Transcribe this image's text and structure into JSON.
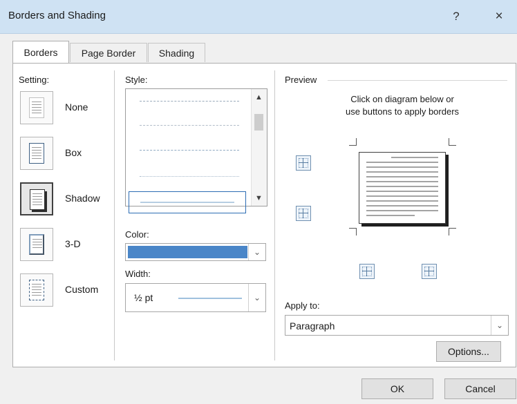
{
  "dialog": {
    "title": "Borders and Shading",
    "help": "?",
    "close": "×"
  },
  "tabs": [
    {
      "label": "Borders",
      "active": true
    },
    {
      "label": "Page Border",
      "active": false
    },
    {
      "label": "Shading",
      "active": false
    }
  ],
  "setting": {
    "heading": "Setting:",
    "options": [
      {
        "label": "None"
      },
      {
        "label": "Box"
      },
      {
        "label": "Shadow",
        "selected": true
      },
      {
        "label": "3-D"
      },
      {
        "label": "Custom"
      }
    ]
  },
  "style": {
    "heading": "Style:"
  },
  "color": {
    "heading": "Color:",
    "value_color": "#4a86c8"
  },
  "width": {
    "heading": "Width:",
    "value": "½ pt"
  },
  "preview": {
    "heading": "Preview",
    "instruction_line1": "Click on diagram below or",
    "instruction_line2": "use buttons to apply borders"
  },
  "apply_to": {
    "heading": "Apply to:",
    "value": "Paragraph"
  },
  "buttons": {
    "options": "Options...",
    "ok": "OK",
    "cancel": "Cancel"
  },
  "colors": {
    "title_bar": "#cfe2f3",
    "accent": "#4a86c8"
  }
}
